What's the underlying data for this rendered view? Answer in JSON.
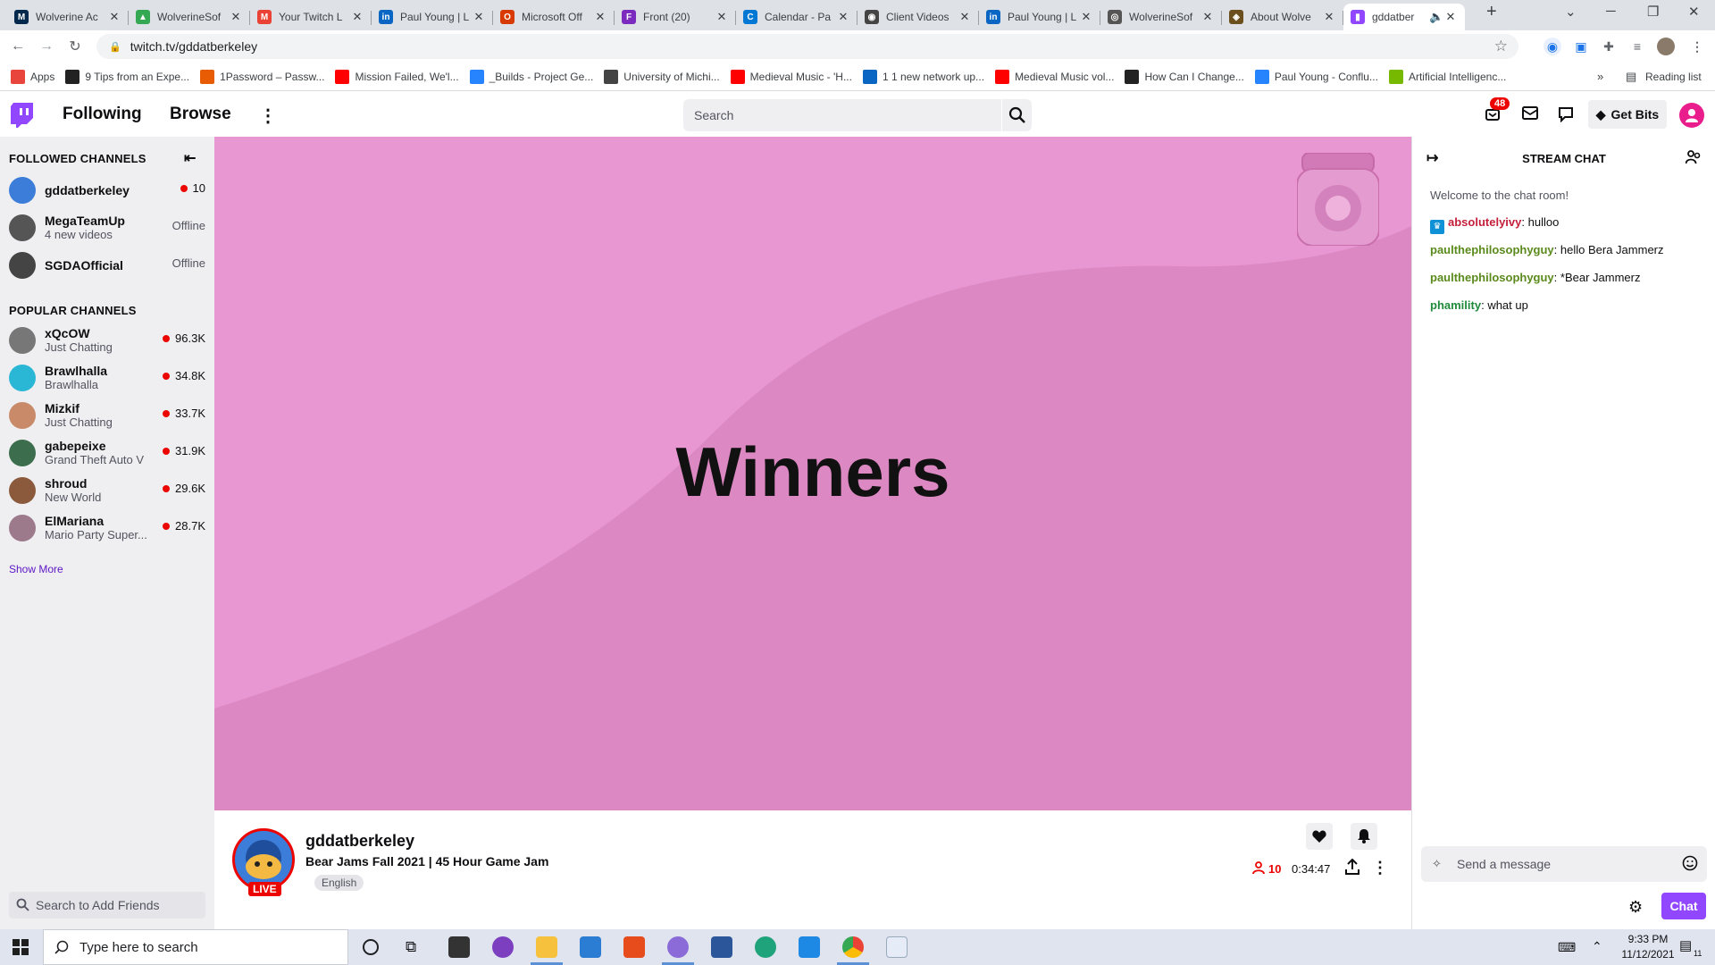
{
  "browser": {
    "tabs": [
      {
        "title": "Wolverine Ac",
        "fav": "M",
        "color": "#00274c"
      },
      {
        "title": "WolverineSof",
        "fav": "▲",
        "color": "#34a853"
      },
      {
        "title": "Your Twitch L",
        "fav": "M",
        "color": "#ea4335"
      },
      {
        "title": "Paul Young | L",
        "fav": "in",
        "color": "#0a66c2"
      },
      {
        "title": "Microsoft Off",
        "fav": "O",
        "color": "#d83b01"
      },
      {
        "title": "Front (20)",
        "fav": "F",
        "color": "#7b2cbf"
      },
      {
        "title": "Calendar - Pa",
        "fav": "C",
        "color": "#0078d4"
      },
      {
        "title": "Client Videos",
        "fav": "◉",
        "color": "#444"
      },
      {
        "title": "Paul Young | L",
        "fav": "in",
        "color": "#0a66c2"
      },
      {
        "title": "WolverineSof",
        "fav": "◎",
        "color": "#555"
      },
      {
        "title": "About Wolve",
        "fav": "◈",
        "color": "#6b4f1d"
      },
      {
        "title": "gddatber",
        "fav": "▮",
        "color": "#9147ff",
        "active": true
      }
    ],
    "url": "twitch.tv/gddatberkeley",
    "bookmarks": [
      {
        "label": "Apps",
        "color": "#e8453c"
      },
      {
        "label": "9 Tips from an Expe...",
        "color": "#222"
      },
      {
        "label": "1Password – Passw...",
        "color": "#e85d04"
      },
      {
        "label": "Mission Failed, We'l...",
        "color": "#ff0000"
      },
      {
        "label": "_Builds - Project Ge...",
        "color": "#2684ff"
      },
      {
        "label": "University of Michi...",
        "color": "#444"
      },
      {
        "label": "Medieval Music - 'H...",
        "color": "#ff0000"
      },
      {
        "label": "1 1 new network up...",
        "color": "#0a66c2"
      },
      {
        "label": "Medieval Music vol...",
        "color": "#ff0000"
      },
      {
        "label": "How Can I Change...",
        "color": "#222"
      },
      {
        "label": "Paul Young - Conflu...",
        "color": "#2684ff"
      },
      {
        "label": "Artificial Intelligenc...",
        "color": "#76b900"
      }
    ],
    "reading_list": "Reading list"
  },
  "twitch": {
    "nav": {
      "following": "Following",
      "browse": "Browse"
    },
    "search_placeholder": "Search",
    "notifications": "48",
    "get_bits": "Get Bits",
    "followed_header": "FOLLOWED CHANNELS",
    "followed": [
      {
        "name": "gddatberkeley",
        "sub": "",
        "status": "10",
        "live": true,
        "color": "#3b7dd8"
      },
      {
        "name": "MegaTeamUp",
        "sub": "4 new videos",
        "status": "Offline",
        "live": false,
        "color": "#555"
      },
      {
        "name": "SGDAOfficial",
        "sub": "",
        "status": "Offline",
        "live": false,
        "color": "#444"
      }
    ],
    "popular_header": "POPULAR CHANNELS",
    "popular": [
      {
        "name": "xQcOW",
        "sub": "Just Chatting",
        "status": "96.3K",
        "color": "#777"
      },
      {
        "name": "Brawlhalla",
        "sub": "Brawlhalla",
        "status": "34.8K",
        "color": "#2ab7d6"
      },
      {
        "name": "Mizkif",
        "sub": "Just Chatting",
        "status": "33.7K",
        "color": "#c98a6a"
      },
      {
        "name": "gabepeixe",
        "sub": "Grand Theft Auto V",
        "status": "31.9K",
        "color": "#3c6e4e"
      },
      {
        "name": "shroud",
        "sub": "New World",
        "status": "29.6K",
        "color": "#8b5a3c"
      },
      {
        "name": "ElMariana",
        "sub": "Mario Party Super...",
        "status": "28.7K",
        "color": "#9c7a8b"
      }
    ],
    "show_more": "Show More",
    "friend_search_placeholder": "Search to Add Friends",
    "video_text": "Winners",
    "stream": {
      "channel": "gddatberkeley",
      "title": "Bear Jams Fall 2021 | 45 Hour Game Jam",
      "tag": "English",
      "live_badge": "LIVE",
      "viewers": "10",
      "uptime": "0:34:47"
    },
    "chat": {
      "header": "STREAM CHAT",
      "welcome": "Welcome to the chat room!",
      "messages": [
        {
          "user": "absolutelyivy",
          "text": " hulloo",
          "color": "#c41e3a"
        },
        {
          "user": "paulthephilosophyguy",
          "text": " hello Bera Jammerz",
          "color": "#5a8a1c"
        },
        {
          "user": "paulthephilosophyguy",
          "text": " *Bear Jammerz",
          "color": "#5a8a1c"
        },
        {
          "user": "phamility",
          "text": " what up",
          "color": "#1f8a3a"
        }
      ],
      "input_placeholder": "Send a message",
      "send_label": "Chat"
    }
  },
  "taskbar": {
    "search_placeholder": "Type here to search",
    "time": "9:33 PM",
    "date": "11/12/2021",
    "notif_count": "11"
  }
}
